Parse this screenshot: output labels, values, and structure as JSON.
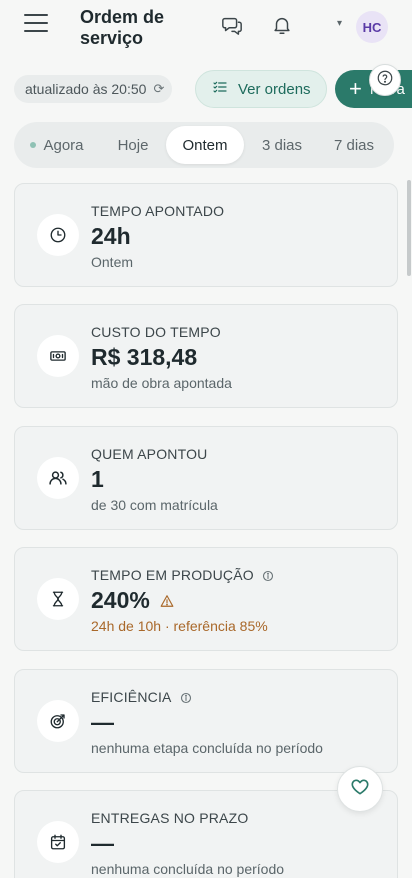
{
  "header": {
    "title": "Ordem de serviço",
    "avatar_initials": "HC"
  },
  "toolbar": {
    "updated_label": "atualizado às 20:50",
    "view_orders_label": "Ver ordens",
    "new_label": "Nova"
  },
  "periods": {
    "items": [
      "Agora",
      "Hoje",
      "Ontem",
      "3 dias",
      "7 dias"
    ],
    "selected": "Ontem"
  },
  "cards": [
    {
      "label": "TEMPO APONTADO",
      "value": "24h",
      "sub": "Ontem",
      "icon": "clock-icon"
    },
    {
      "label": "CUSTO DO TEMPO",
      "value": "R$ 318,48",
      "sub": "mão de obra apontada",
      "icon": "money-icon"
    },
    {
      "label": "QUEM APONTOU",
      "value": "1",
      "sub": "de 30 com matrícula",
      "icon": "users-icon"
    },
    {
      "label": "TEMPO EM PRODUÇÃO",
      "value": "240%",
      "sub": "24h de 10h · referência 85%",
      "icon": "hourglass-icon",
      "has_info": true,
      "warning": true
    },
    {
      "label": "EFICIÊNCIA",
      "value": "—",
      "sub": "nenhuma etapa concluída no período",
      "icon": "target-icon",
      "has_info": true
    },
    {
      "label": "ENTREGAS NO PRAZO",
      "value": "—",
      "sub": "nenhuma concluída no período",
      "icon": "calendar-check-icon"
    }
  ],
  "colors": {
    "accent": "#2b7a6a",
    "accent_light": "#e3f0ec",
    "warning": "#a9682a",
    "avatar_bg": "#e9e3f6",
    "avatar_text": "#5a3aa6"
  }
}
